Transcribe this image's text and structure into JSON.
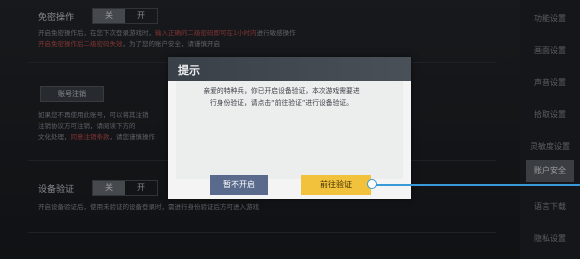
{
  "settings": {
    "row1": {
      "label": "免密操作",
      "toggle": {
        "on_label": "关",
        "off_label": "开"
      }
    },
    "row1_desc": {
      "line1_a": "开启免密操作后，在您下次登录游戏时，",
      "line1_red": "输入正确的二级密码即可在1小时内",
      "line1_b": "进行敏感操作",
      "line2_red": "开启免密操作后二级密码失效",
      "line2_b": "，为了您的账户安全，请谨慎开启"
    },
    "logout_button": "账号注销",
    "logout_desc": {
      "line1": "如果您不再使用此账号，可以将其注销",
      "line2_a": "注销协议方可注销，请阅读下方的",
      "line3_a": "文化处理",
      "line3_red": "同意注销条款",
      "line3_b": "，请您谨慎操作"
    },
    "device_verify": {
      "label": "设备验证",
      "toggle": {
        "on_label": "关",
        "off_label": "开"
      }
    },
    "device_desc": "开启设备验证后，使用未验证的设备登录时，需进行身份验证后方可进入游戏"
  },
  "sidebar": {
    "items": [
      "功能设置",
      "画面设置",
      "声音设置",
      "拾取设置",
      "灵敏度设置",
      "账户安全",
      "语言下载",
      "隐私设置"
    ],
    "active_index": 5
  },
  "dialog": {
    "title": "提示",
    "message_line1": "亲爱的特种兵，你已开启设备验证，本次游戏需要进",
    "message_line2": "行身份验证，请点击“前往验证”进行设备验证。",
    "cancel_label": "暂不开启",
    "confirm_label": "前往验证"
  },
  "colors": {
    "confirm": "#f2c23c",
    "cancel": "#5a6a8c",
    "pointer": "#3a9ad8",
    "warning_red": "#c65050"
  }
}
